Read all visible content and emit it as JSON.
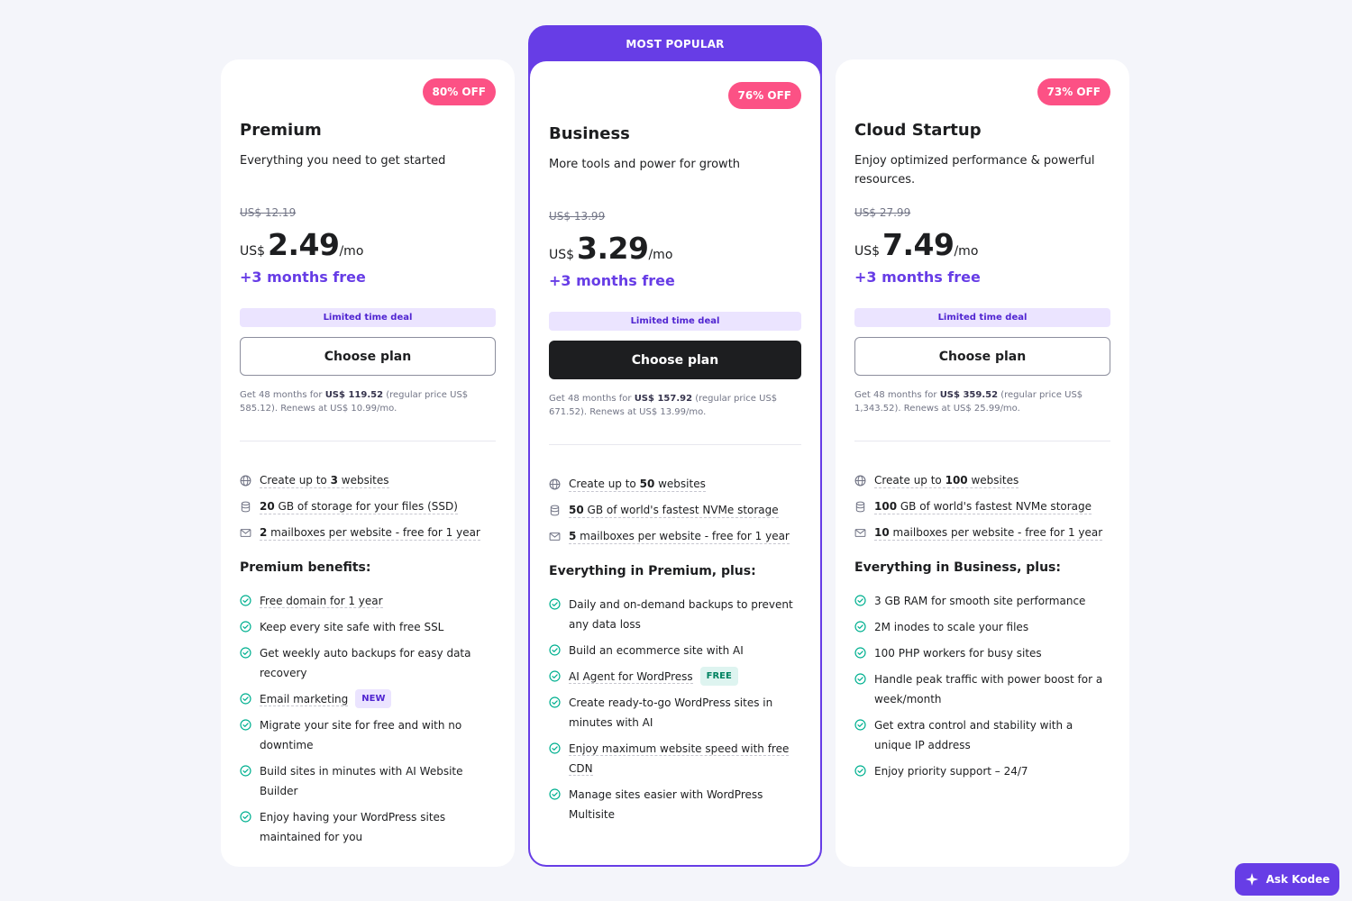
{
  "colors": {
    "brand_purple": "#673de6",
    "discount_pink": "#fc5185",
    "check_green": "#00b090",
    "dark_button": "#1d1e20",
    "page_bg": "#f4f5fa"
  },
  "plans": [
    {
      "discount": "80% OFF",
      "name": "Premium",
      "description": "Everything you need to get started",
      "old_price": "US$ 12.19",
      "currency": "US$",
      "price": "2.49",
      "per": "/mo",
      "bonus": "+3 months free",
      "deal": "Limited time deal",
      "cta": "Choose plan",
      "fine_prefix": "Get 48 months for ",
      "fine_total": "US$ 119.52",
      "fine_suffix": " (regular price US$ 585.12). Renews at US$ 10.99/mo.",
      "features": [
        {
          "icon": "globe-icon",
          "pre": "Create up to ",
          "bold": "3",
          "post": " websites"
        },
        {
          "icon": "storage-icon",
          "pre": "",
          "bold": "20",
          "post": " GB of storage for your files (SSD)"
        },
        {
          "icon": "mail-icon",
          "pre": "",
          "bold": "2",
          "post": " mailboxes per website - free for 1 year"
        }
      ],
      "benefits_heading": "Premium benefits:",
      "benefits": [
        {
          "text": "Free domain for 1 year",
          "underline": true
        },
        {
          "text": "Keep every site safe with free SSL",
          "underline": false
        },
        {
          "text": "Get weekly auto backups for easy data recovery",
          "underline": false
        },
        {
          "text": "Email marketing",
          "underline": true,
          "tag": "NEW"
        },
        {
          "text": "Migrate your site for free and with no downtime",
          "underline": false
        },
        {
          "text": "Build sites in minutes with AI Website Builder",
          "underline": false
        },
        {
          "text": "Enjoy having your WordPress sites maintained for you",
          "underline": false
        }
      ]
    },
    {
      "ribbon": "MOST POPULAR",
      "discount": "76% OFF",
      "name": "Business",
      "description": "More tools and power for growth",
      "old_price": "US$ 13.99",
      "currency": "US$",
      "price": "3.29",
      "per": "/mo",
      "bonus": "+3 months free",
      "deal": "Limited time deal",
      "cta": "Choose plan",
      "fine_prefix": "Get 48 months for ",
      "fine_total": "US$ 157.92",
      "fine_suffix": " (regular price US$ 671.52). Renews at US$ 13.99/mo.",
      "features": [
        {
          "icon": "globe-icon",
          "pre": "Create up to ",
          "bold": "50",
          "post": " websites"
        },
        {
          "icon": "storage-icon",
          "pre": "",
          "bold": "50",
          "post": " GB of world's fastest NVMe storage"
        },
        {
          "icon": "mail-icon",
          "pre": "",
          "bold": "5",
          "post": " mailboxes per website - free for 1 year"
        }
      ],
      "benefits_heading": "Everything in Premium, plus:",
      "benefits": [
        {
          "text": "Daily and on-demand backups to prevent any data loss",
          "underline": false
        },
        {
          "text": "Build an ecommerce site with AI",
          "underline": false
        },
        {
          "text": "AI Agent for WordPress",
          "underline": true,
          "tag": "FREE"
        },
        {
          "text": "Create ready-to-go WordPress sites in minutes with AI",
          "underline": false
        },
        {
          "text": "Enjoy maximum website speed with free CDN",
          "underline": true
        },
        {
          "text": "Manage sites easier with WordPress Multisite",
          "underline": false
        }
      ]
    },
    {
      "discount": "73% OFF",
      "name": "Cloud Startup",
      "description": "Enjoy optimized performance & powerful resources.",
      "old_price": "US$ 27.99",
      "currency": "US$",
      "price": "7.49",
      "per": "/mo",
      "bonus": "+3 months free",
      "deal": "Limited time deal",
      "cta": "Choose plan",
      "fine_prefix": "Get 48 months for ",
      "fine_total": "US$ 359.52",
      "fine_suffix": " (regular price US$ 1,343.52). Renews at US$ 25.99/mo.",
      "features": [
        {
          "icon": "globe-icon",
          "pre": "Create up to ",
          "bold": "100",
          "post": " websites"
        },
        {
          "icon": "storage-icon",
          "pre": "",
          "bold": "100",
          "post": " GB of world's fastest NVMe storage"
        },
        {
          "icon": "mail-icon",
          "pre": "",
          "bold": "10",
          "post": " mailboxes per website - free for 1 year"
        }
      ],
      "benefits_heading": "Everything in Business, plus:",
      "benefits": [
        {
          "text": "3 GB RAM for smooth site performance",
          "underline": false
        },
        {
          "text": "2M inodes to scale your files",
          "underline": false
        },
        {
          "text": "100 PHP workers for busy sites",
          "underline": false
        },
        {
          "text": "Handle peak traffic with power boost for a week/month",
          "underline": false
        },
        {
          "text": "Get extra control and stability with a unique IP address",
          "underline": false
        },
        {
          "text": "Enjoy priority support – 24/7",
          "underline": false
        }
      ]
    }
  ],
  "assistant": {
    "label": "Ask Kodee",
    "icon": "kodee-icon"
  }
}
